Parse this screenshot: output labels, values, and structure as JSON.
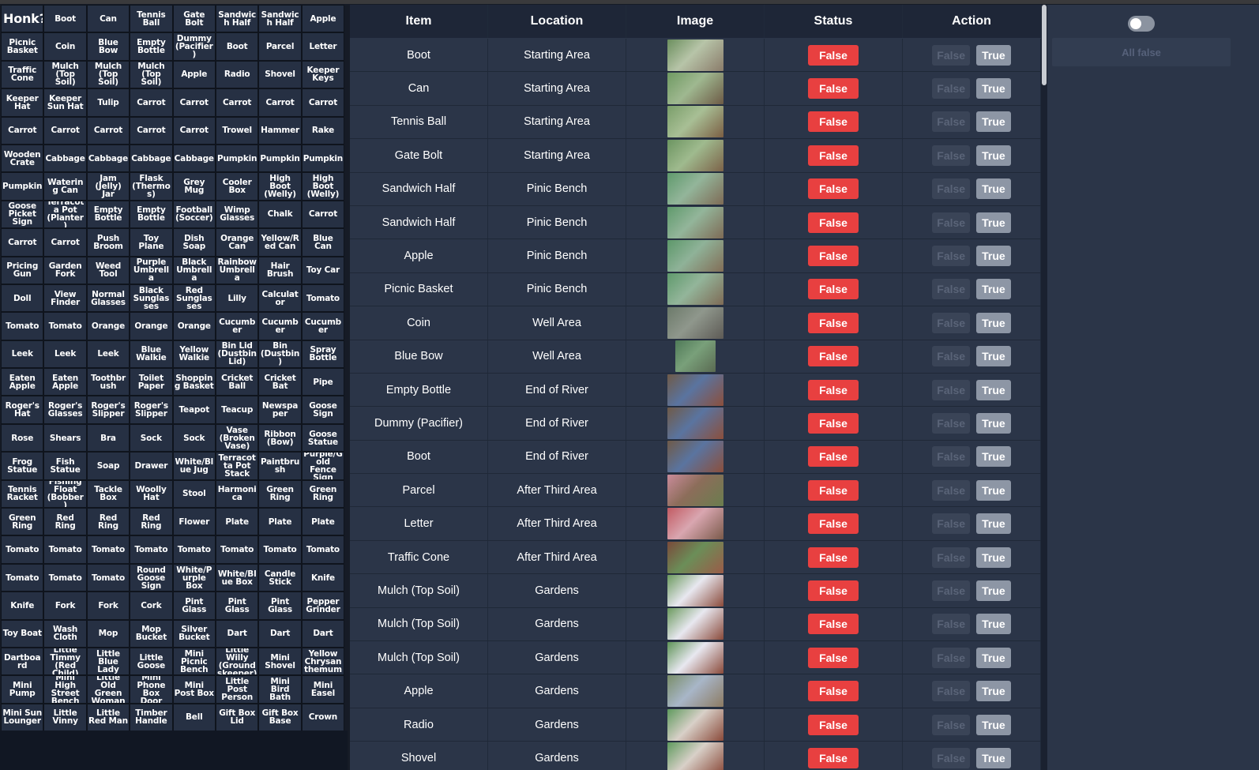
{
  "grid": {
    "title": "Honk?",
    "cells": [
      "Boot",
      "Can",
      "Tennis Ball",
      "Gate Bolt",
      "Sandwich Half",
      "Sandwich Half",
      "Apple",
      "Picnic Basket",
      "Coin",
      "Blue Bow",
      "Empty Bottle",
      "Dummy (Pacifier)",
      "Boot",
      "Parcel",
      "Letter",
      "Traffic Cone",
      "Mulch (Top Soil)",
      "Mulch (Top Soil)",
      "Mulch (Top Soil)",
      "Apple",
      "Radio",
      "Shovel",
      "Keeper Keys",
      "Keeper Hat",
      "Keeper Sun Hat",
      "Tulip",
      "Carrot",
      "Carrot",
      "Carrot",
      "Carrot",
      "Carrot",
      "Carrot",
      "Carrot",
      "Carrot",
      "Carrot",
      "Carrot",
      "Trowel",
      "Hammer",
      "Rake",
      "Wooden Crate",
      "Cabbage",
      "Cabbage",
      "Cabbage",
      "Cabbage",
      "Pumpkin",
      "Pumpkin",
      "Pumpkin",
      "Pumpkin",
      "Watering Can",
      "Jam (Jelly) Jar",
      "Flask (Thermos)",
      "Grey Mug",
      "Cooler Box",
      "High Boot (Welly)",
      "High Boot (Welly)",
      "Goose Picket Sign",
      "Terracota Pot (Planter)",
      "Empty Bottle",
      "Empty Bottle",
      "Football (Soccer)",
      "Wimp Glasses",
      "Chalk",
      "Carrot",
      "Carrot",
      "Carrot",
      "Push Broom",
      "Toy Plane",
      "Dish Soap",
      "Orange Can",
      "Yellow/Red Can",
      "Blue Can",
      "Pricing Gun",
      "Garden Fork",
      "Weed Tool",
      "Purple Umbrella",
      "Black Umbrella",
      "Rainbow Umbrella",
      "Hair Brush",
      "Toy Car",
      "Doll",
      "View Finder",
      "Normal Glasses",
      "Black Sunglasses",
      "Red Sunglasses",
      "Lilly",
      "Calculator",
      "Tomato",
      "Tomato",
      "Tomato",
      "Orange",
      "Orange",
      "Orange",
      "Cucumber",
      "Cucumber",
      "Cucumber",
      "Leek",
      "Leek",
      "Leek",
      "Blue Walkie",
      "Yellow Walkie",
      "Bin Lid (Dustbin Lid)",
      "Bin (Dustbin)",
      "Spray Bottle",
      "Eaten Apple",
      "Eaten Apple",
      "Toothbrush",
      "Toilet Paper",
      "Shopping Basket",
      "Cricket Ball",
      "Cricket Bat",
      "Pipe",
      "Roger's Hat",
      "Roger's Glasses",
      "Roger's Slipper",
      "Roger's Slipper",
      "Teapot",
      "Teacup",
      "Newspaper",
      "Goose Sign",
      "Rose",
      "Shears",
      "Bra",
      "Sock",
      "Sock",
      "Vase (Broken Vase)",
      "Ribbon (Bow)",
      "Goose Statue",
      "Frog Statue",
      "Fish Statue",
      "Soap",
      "Drawer",
      "White/Blue Jug",
      "Terracotta Pot Stack",
      "Paintbrush",
      "Purple/Gold Fence Sign",
      "Tennis Racket",
      "Fishing Float (Bobber)",
      "Tackle Box",
      "Woolly Hat",
      "Stool",
      "Harmonica",
      "Green Ring",
      "Green Ring",
      "Green Ring",
      "Red Ring",
      "Red Ring",
      "Red Ring",
      "Flower",
      "Plate",
      "Plate",
      "Plate",
      "Tomato",
      "Tomato",
      "Tomato",
      "Tomato",
      "Tomato",
      "Tomato",
      "Tomato",
      "Tomato",
      "Tomato",
      "Tomato",
      "Tomato",
      "Round Goose Sign",
      "White/Purple Box",
      "White/Blue Box",
      "Candle Stick",
      "Knife",
      "Knife",
      "Fork",
      "Fork",
      "Cork",
      "Pint Glass",
      "Pint Glass",
      "Pint Glass",
      "Pepper Grinder",
      "Toy Boat",
      "Wash Cloth",
      "Mop",
      "Mop Bucket",
      "Silver Bucket",
      "Dart",
      "Dart",
      "Dart",
      "Dartboard",
      "Little Timmy (Red Child)",
      "Little Blue Lady",
      "Little Goose",
      "Mini Picnic Bench",
      "Little Willy (Groundskeeper)",
      "Mini Shovel",
      "Yellow Chrysanthemum",
      "Mini Pump",
      "Mini High Street Bench",
      "Little Old Green Woman",
      "Mini Phone Box Door",
      "Mini Post Box",
      "Little Post Person",
      "Mini Bird Bath",
      "Mini Easel",
      "Mini Sun Lounger",
      "Little Vinny",
      "Little Red Man",
      "Timber Handle",
      "Bell",
      "Gift Box Lid",
      "Gift Box Base",
      "Crown"
    ]
  },
  "table": {
    "headers": {
      "item": "Item",
      "location": "Location",
      "image": "Image",
      "status": "Status",
      "action": "Action"
    },
    "rows": [
      {
        "item": "Boot",
        "location": "Starting Area",
        "status": "False",
        "false_label": "False",
        "true_label": "True"
      },
      {
        "item": "Can",
        "location": "Starting Area",
        "status": "False",
        "false_label": "False",
        "true_label": "True"
      },
      {
        "item": "Tennis Ball",
        "location": "Starting Area",
        "status": "False",
        "false_label": "False",
        "true_label": "True"
      },
      {
        "item": "Gate Bolt",
        "location": "Starting Area",
        "status": "False",
        "false_label": "False",
        "true_label": "True"
      },
      {
        "item": "Sandwich Half",
        "location": "Pinic Bench",
        "status": "False",
        "false_label": "False",
        "true_label": "True"
      },
      {
        "item": "Sandwich Half",
        "location": "Pinic Bench",
        "status": "False",
        "false_label": "False",
        "true_label": "True"
      },
      {
        "item": "Apple",
        "location": "Pinic Bench",
        "status": "False",
        "false_label": "False",
        "true_label": "True"
      },
      {
        "item": "Picnic Basket",
        "location": "Pinic Bench",
        "status": "False",
        "false_label": "False",
        "true_label": "True"
      },
      {
        "item": "Coin",
        "location": "Well Area",
        "status": "False",
        "false_label": "False",
        "true_label": "True"
      },
      {
        "item": "Blue Bow",
        "location": "Well Area",
        "status": "False",
        "false_label": "False",
        "true_label": "True"
      },
      {
        "item": "Empty Bottle",
        "location": "End of River",
        "status": "False",
        "false_label": "False",
        "true_label": "True"
      },
      {
        "item": "Dummy (Pacifier)",
        "location": "End of River",
        "status": "False",
        "false_label": "False",
        "true_label": "True"
      },
      {
        "item": "Boot",
        "location": "End of River",
        "status": "False",
        "false_label": "False",
        "true_label": "True"
      },
      {
        "item": "Parcel",
        "location": "After Third Area",
        "status": "False",
        "false_label": "False",
        "true_label": "True"
      },
      {
        "item": "Letter",
        "location": "After Third Area",
        "status": "False",
        "false_label": "False",
        "true_label": "True"
      },
      {
        "item": "Traffic Cone",
        "location": "After Third Area",
        "status": "False",
        "false_label": "False",
        "true_label": "True"
      },
      {
        "item": "Mulch (Top Soil)",
        "location": "Gardens",
        "status": "False",
        "false_label": "False",
        "true_label": "True"
      },
      {
        "item": "Mulch (Top Soil)",
        "location": "Gardens",
        "status": "False",
        "false_label": "False",
        "true_label": "True"
      },
      {
        "item": "Mulch (Top Soil)",
        "location": "Gardens",
        "status": "False",
        "false_label": "False",
        "true_label": "True"
      },
      {
        "item": "Apple",
        "location": "Gardens",
        "status": "False",
        "false_label": "False",
        "true_label": "True"
      },
      {
        "item": "Radio",
        "location": "Gardens",
        "status": "False",
        "false_label": "False",
        "true_label": "True"
      },
      {
        "item": "Shovel",
        "location": "Gardens",
        "status": "False",
        "false_label": "False",
        "true_label": "True"
      }
    ]
  },
  "right_panel": {
    "all_false_label": "All false",
    "toggle_on": false
  },
  "colors": {
    "status_false": "#e84040",
    "true_button": "#8d96a5"
  }
}
